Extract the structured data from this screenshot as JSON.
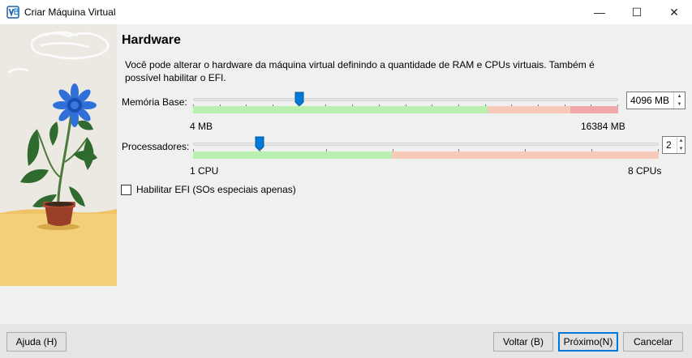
{
  "window": {
    "title": "Criar Máquina Virtual",
    "minimize_icon": "—",
    "maximize_icon": "☐",
    "close_icon": "✕"
  },
  "page": {
    "heading": "Hardware",
    "description": "Você pode alterar o hardware da máquina virtual definindo a quantidade de RAM e CPUs virtuais. Também é possível habilitar o EFI."
  },
  "memory": {
    "label": "Memória Base:",
    "value": "4096 MB",
    "min_label": "4 MB",
    "max_label": "16384 MB",
    "fraction": 0.25
  },
  "cpu": {
    "label": "Processadores:",
    "value": "2",
    "min_label": "1 CPU",
    "max_label": "8 CPUs",
    "fraction": 0.143
  },
  "efi": {
    "label": "Habilitar EFI (SOs especiais apenas)",
    "checked": false
  },
  "buttons": {
    "help": "Ajuda (H)",
    "back": "Voltar (B)",
    "next": "Próximo(N)",
    "cancel": "Cancelar"
  },
  "colors": {
    "zone_green": "#b8f0b0",
    "zone_orange": "#f6c9b8",
    "zone_red": "#f2a8a8",
    "handle_blue": "#0078d7"
  }
}
